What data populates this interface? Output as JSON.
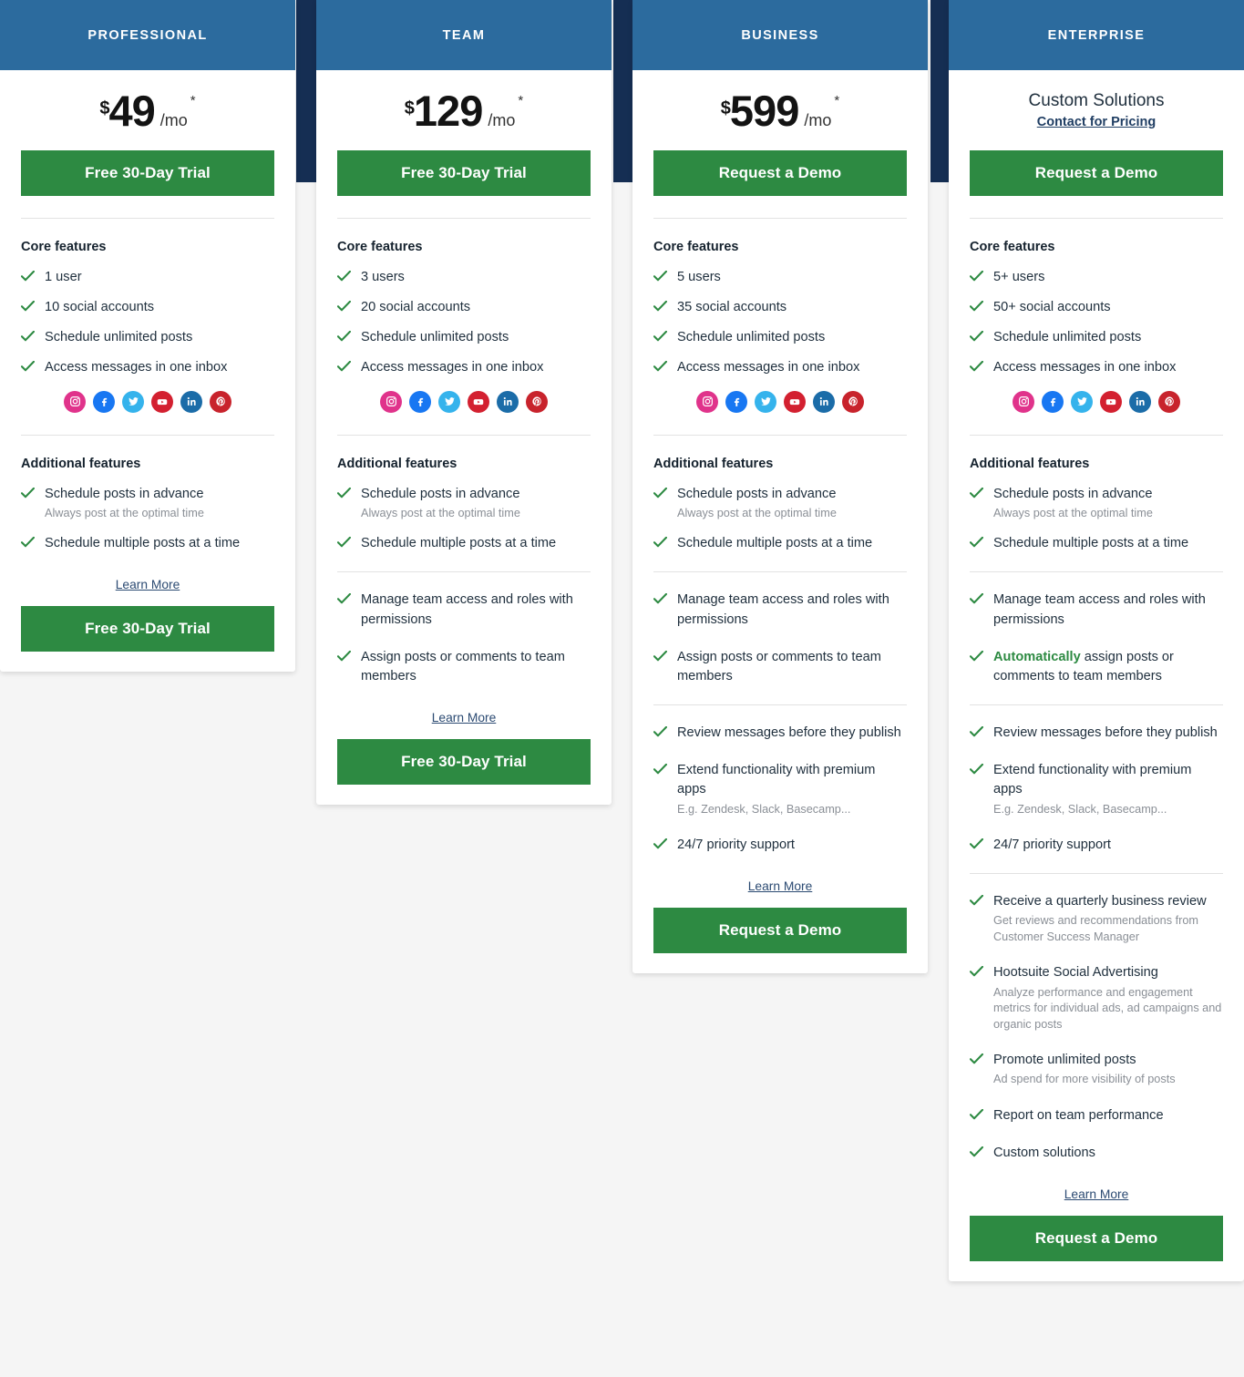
{
  "theme": {
    "header_blue": "#2c6b9e",
    "gutter_navy": "#152e53",
    "cta_green": "#2d8a42",
    "link_blue": "#2b4a72",
    "page_bg": "#f5f5f5"
  },
  "labels": {
    "core_features": "Core features",
    "additional_features": "Additional features",
    "learn_more": "Learn More",
    "per_month": "/mo",
    "asterisk": "*",
    "currency": "$"
  },
  "social_icons": [
    {
      "name": "instagram-icon",
      "color": "#e0338b"
    },
    {
      "name": "facebook-icon",
      "color": "#1877f2"
    },
    {
      "name": "twitter-icon",
      "color": "#35b3ec"
    },
    {
      "name": "youtube-icon",
      "color": "#d32030"
    },
    {
      "name": "linkedin-icon",
      "color": "#1b6ca8"
    },
    {
      "name": "pinterest-icon",
      "color": "#c8232c"
    }
  ],
  "plans": [
    {
      "id": "professional",
      "name": "PROFESSIONAL",
      "price": "49",
      "cta_label": "Free 30-Day Trial",
      "bottom_cta_label": "Free 30-Day Trial",
      "core_features": [
        "1 user",
        "10 social accounts",
        "Schedule unlimited posts",
        "Access messages in one inbox"
      ],
      "additional_groups": [
        [
          {
            "text": "Schedule posts in advance",
            "sub": "Always post at the optimal time"
          },
          {
            "text": "Schedule multiple posts at a time"
          }
        ]
      ]
    },
    {
      "id": "team",
      "name": "TEAM",
      "price": "129",
      "cta_label": "Free 30-Day Trial",
      "bottom_cta_label": "Free 30-Day Trial",
      "core_features": [
        "3 users",
        "20 social accounts",
        "Schedule unlimited posts",
        "Access messages in one inbox"
      ],
      "additional_groups": [
        [
          {
            "text": "Schedule posts in advance",
            "sub": "Always post at the optimal time"
          },
          {
            "text": "Schedule multiple posts at a time"
          }
        ],
        [
          {
            "text": "Manage team access and roles with permissions"
          },
          {
            "text": "Assign posts or comments to team members"
          }
        ]
      ]
    },
    {
      "id": "business",
      "name": "BUSINESS",
      "price": "599",
      "cta_label": "Request a Demo",
      "bottom_cta_label": "Request a Demo",
      "core_features": [
        "5 users",
        "35 social accounts",
        "Schedule unlimited posts",
        "Access messages in one inbox"
      ],
      "additional_groups": [
        [
          {
            "text": "Schedule posts in advance",
            "sub": "Always post at the optimal time"
          },
          {
            "text": "Schedule multiple posts at a time"
          }
        ],
        [
          {
            "text": "Manage team access and roles with permissions"
          },
          {
            "text": "Assign posts or comments to team members"
          }
        ],
        [
          {
            "text": "Review messages before they publish"
          },
          {
            "text": "Extend functionality with premium apps",
            "sub": "E.g. Zendesk, Slack, Basecamp..."
          },
          {
            "text": "24/7 priority support"
          }
        ]
      ]
    },
    {
      "id": "enterprise",
      "name": "ENTERPRISE",
      "custom_price_label": "Custom Solutions",
      "contact_link_label": "Contact for Pricing",
      "cta_label": "Request a Demo",
      "bottom_cta_label": "Request a Demo",
      "core_features": [
        "5+ users",
        "50+ social accounts",
        "Schedule unlimited posts",
        "Access messages in one inbox"
      ],
      "additional_groups": [
        [
          {
            "text": "Schedule posts in advance",
            "sub": "Always post at the optimal time"
          },
          {
            "text": "Schedule multiple posts at a time"
          }
        ],
        [
          {
            "text": "Manage team access and roles with permissions"
          },
          {
            "highlight": "Automatically",
            "text": " assign posts or comments to team members"
          }
        ],
        [
          {
            "text": "Review messages before they publish"
          },
          {
            "text": "Extend functionality with premium apps",
            "sub": "E.g. Zendesk, Slack, Basecamp..."
          },
          {
            "text": "24/7 priority support"
          }
        ],
        [
          {
            "text": "Receive a quarterly business review",
            "sub": "Get reviews and recommendations from Customer Success Manager"
          },
          {
            "text": "Hootsuite Social Advertising",
            "sub": "Analyze performance and engagement metrics for individual ads, ad campaigns and organic posts"
          },
          {
            "text": "Promote unlimited posts",
            "sub": "Ad spend for more visibility of posts"
          },
          {
            "text": "Report on team performance"
          },
          {
            "text": "Custom solutions"
          }
        ]
      ]
    }
  ]
}
